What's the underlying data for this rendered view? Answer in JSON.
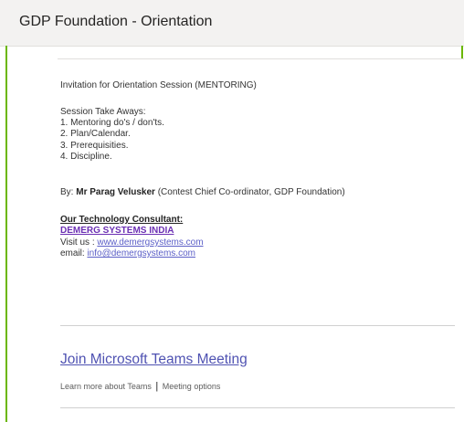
{
  "header": {
    "title": "GDP Foundation - Orientation"
  },
  "colors": {
    "accent": "#6bb700",
    "link": "#5b5fc7",
    "consultant": "#6b2fb3"
  },
  "body": {
    "invitation": "Invitation for Orientation Session (MENTORING)",
    "takeaways_heading": "Session Take Aways:",
    "takeaways": [
      "1. Mentoring do's / don'ts.",
      "2. Plan/Calendar.",
      "3. Prerequisities.",
      "4. Discipline."
    ],
    "by_prefix": "By: ",
    "by_name": "Mr Parag Velusker",
    "by_suffix": " (Contest Chief Co-ordinator, GDP Foundation)",
    "consultant_heading": "Our Technology Consultant:",
    "consultant_name": "DEMERG SYSTEMS INDIA",
    "visit_prefix": "Visit us : ",
    "visit_link": "www.demergsystems.com",
    "email_prefix": "email: ",
    "email_link": "info@demergsystems.com"
  },
  "teams": {
    "join_label": "Join Microsoft Teams Meeting",
    "learn_more": "Learn more about Teams",
    "separator": "|",
    "meeting_options": "Meeting options"
  }
}
